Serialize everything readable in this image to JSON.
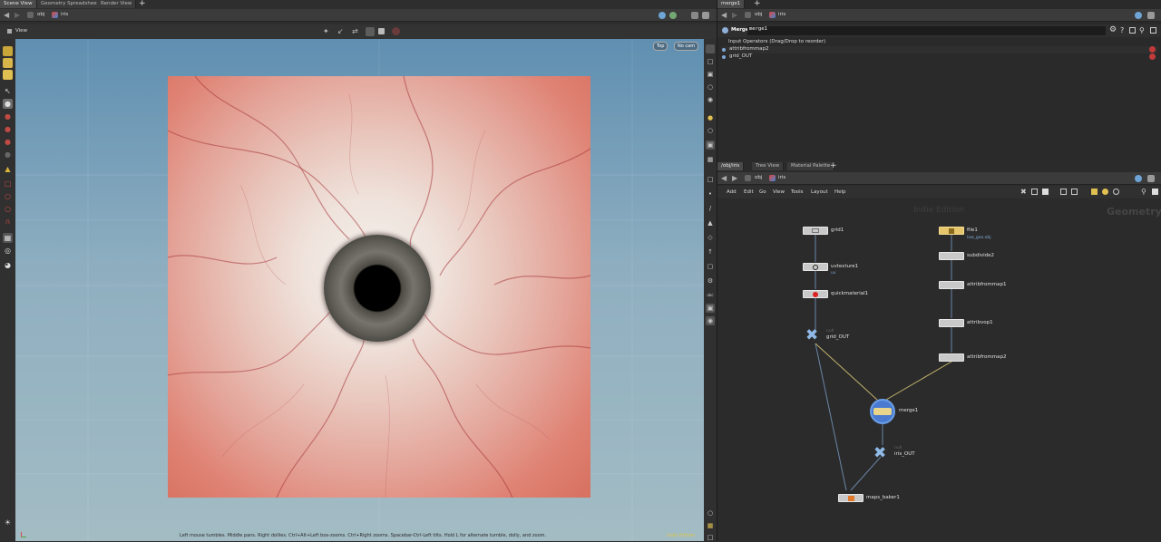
{
  "left_tabs": [
    "Scene View",
    "Geometry Spreadsheet",
    "Render View"
  ],
  "left_path": [
    "obj",
    "iris"
  ],
  "viewport": {
    "label": "View",
    "camera_top": "Top",
    "camera_none": "No cam",
    "status_text": "Left mouse tumbles. Middle pans. Right dollies. Ctrl+Alt+Left box-zooms. Ctrl+Right zooms. Spacebar-Ctrl-Left tilts. Hold L for alternate tumble, dolly, and zoom.",
    "corner_text": "Indie Edition"
  },
  "params": {
    "tab": "merge1",
    "path": [
      "obj",
      "iris"
    ],
    "node_type": "Merge",
    "node_name": "merge1",
    "section": "Input Operators (Drag/Drop to reorder)",
    "inputs": [
      "attribfrommap2",
      "grid_OUT"
    ]
  },
  "network": {
    "tabs": [
      "/obj/iris",
      "Tree View",
      "Material Palette"
    ],
    "path": [
      "obj",
      "iris"
    ],
    "menu": [
      "Add",
      "Edit",
      "Go",
      "View",
      "Tools",
      "Layout",
      "Help"
    ],
    "watermark": "Indie Edition",
    "context": "Geometry",
    "nodes": {
      "grid1": "grid1",
      "uvtexture1": "uvtexture1",
      "uvtexture1_sub": "uv",
      "quickmaterial1": "quickmaterial1",
      "grid_out": "grid_OUT",
      "grid_out_tag": "null",
      "file1": "file1",
      "file1_sub": "low_geo.obj",
      "subdivide2": "subdivide2",
      "attribfrommap1": "attribfrommap1",
      "attribwop1": "attribvop1",
      "attribfrommap2": "attribfrommap2",
      "merge1": "merge1",
      "iris_out": "iris_OUT",
      "iris_out_tag": "null",
      "maps_baker1": "maps_baker1"
    }
  },
  "colors": {
    "accent_blue": "#7fa8d8",
    "merge_ring": "#4a7bd1",
    "file_node": "#e7c56a"
  }
}
